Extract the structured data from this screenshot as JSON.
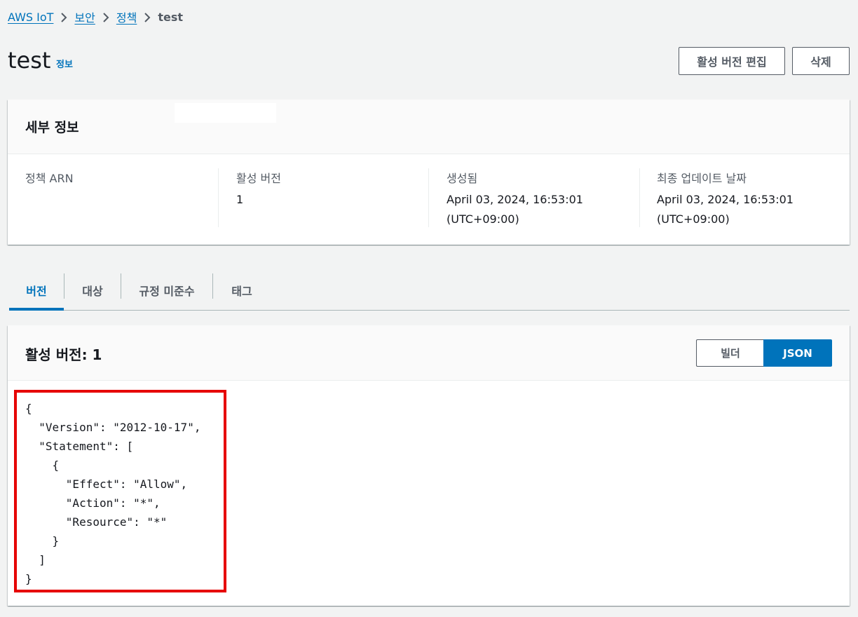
{
  "breadcrumb": {
    "items": [
      "AWS IoT",
      "보안",
      "정책"
    ],
    "current": "test"
  },
  "header": {
    "title": "test",
    "info_label": "정보",
    "edit_button": "활성 버전 편집",
    "delete_button": "삭제"
  },
  "details": {
    "title": "세부 정보",
    "fields": [
      {
        "label": "정책 ARN",
        "value": ""
      },
      {
        "label": "활성 버전",
        "value": "1"
      },
      {
        "label": "생성됨",
        "value": "April 03, 2024, 16:53:01",
        "value2": "(UTC+09:00)"
      },
      {
        "label": "최종 업데이트 날짜",
        "value": "April 03, 2024, 16:53:01",
        "value2": "(UTC+09:00)"
      }
    ]
  },
  "tabs": [
    {
      "label": "버전",
      "active": true
    },
    {
      "label": "대상",
      "active": false
    },
    {
      "label": "규정 미준수",
      "active": false
    },
    {
      "label": "태그",
      "active": false
    }
  ],
  "version": {
    "title": "활성 버전: 1",
    "view_options": {
      "builder": "빌더",
      "json": "JSON",
      "selected": "JSON"
    },
    "policy_json": "{\n  \"Version\": \"2012-10-17\",\n  \"Statement\": [\n    {\n      \"Effect\": \"Allow\",\n      \"Action\": \"*\",\n      \"Resource\": \"*\"\n    }\n  ]\n}"
  },
  "colors": {
    "accent": "#0073bb",
    "highlight_border": "#e60000",
    "background": "#f2f3f3"
  }
}
